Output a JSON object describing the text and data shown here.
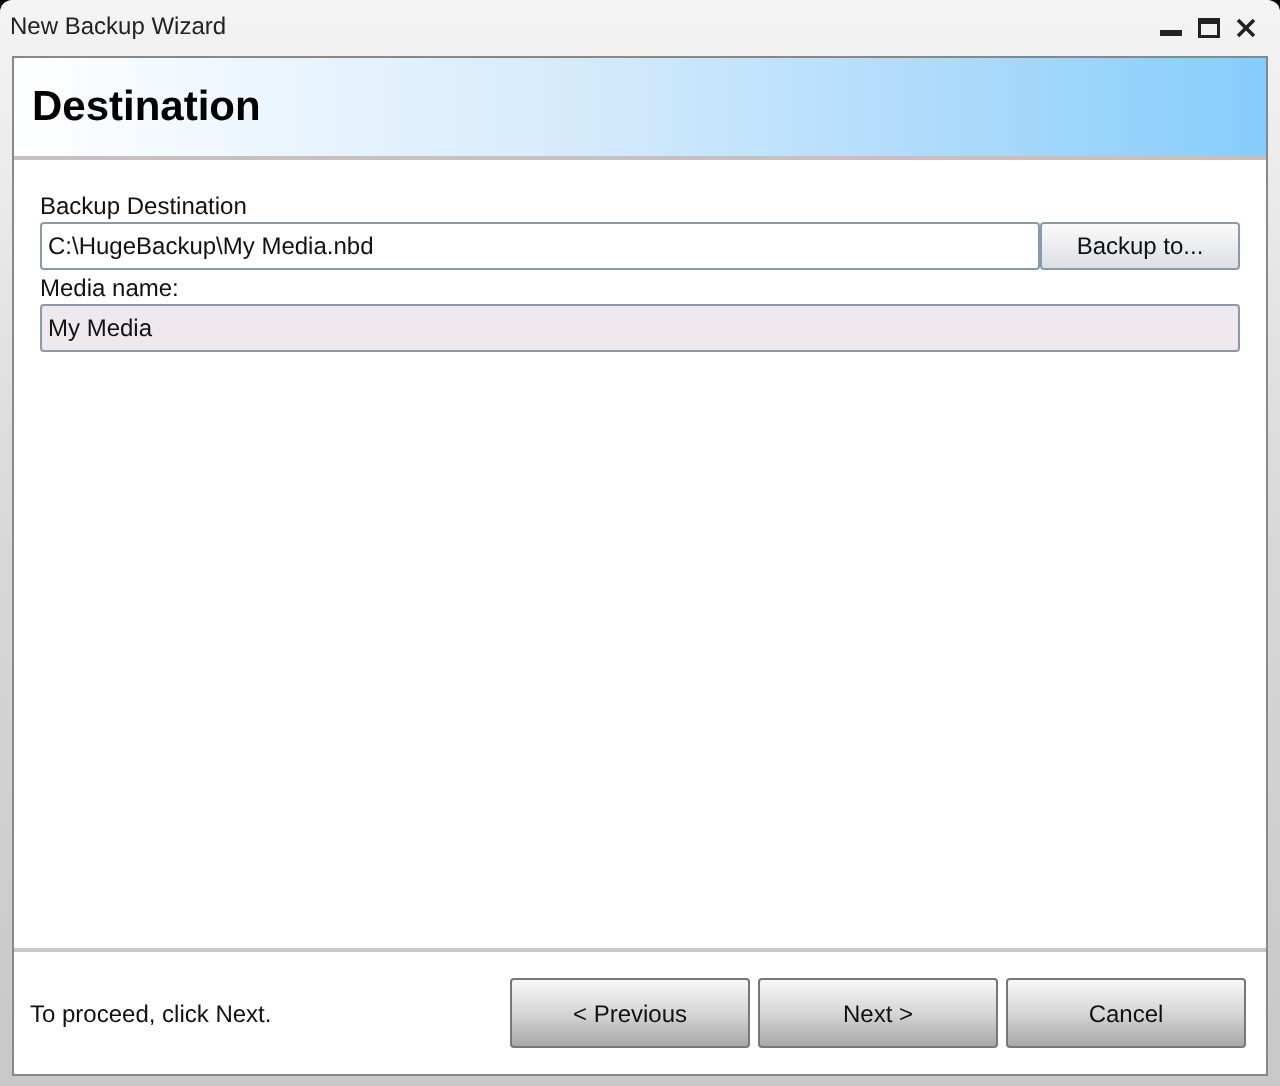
{
  "window": {
    "title": "New Backup Wizard"
  },
  "header": {
    "title": "Destination"
  },
  "fields": [
    {
      "label": "Backup Destination",
      "value": "C:\\HugeBackup\\My Media.nbd",
      "read_only": false,
      "button": "Backup to..."
    },
    {
      "label": "Media name:",
      "value": "My Media",
      "read_only": true
    }
  ],
  "footer": {
    "hint": "To proceed, click Next.",
    "buttons": [
      "< Previous",
      "Next >",
      "Cancel"
    ]
  }
}
